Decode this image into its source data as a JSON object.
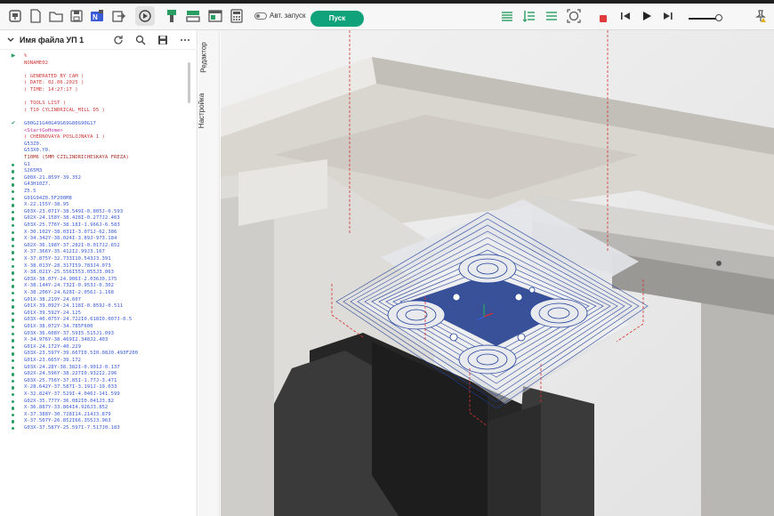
{
  "toolbar": {
    "auto_run_label": "Авт. запуск",
    "run_label": "Пуск"
  },
  "panel": {
    "file_title": "Имя файла УП 1",
    "tabs": [
      "Редактор",
      "Настройка"
    ]
  },
  "code_lines": [
    {
      "marker": "arrow",
      "text": "%",
      "style": "red"
    },
    {
      "marker": "",
      "text": "NONAME02",
      "style": "red"
    },
    {
      "marker": "",
      "text": "",
      "style": "red"
    },
    {
      "marker": "",
      "text": "( GENERATED BY CAM )",
      "style": "red"
    },
    {
      "marker": "",
      "text": "( DATE: 02.06.2025 )",
      "style": "red"
    },
    {
      "marker": "",
      "text": "( TIME: 14:27:17 )",
      "style": "red"
    },
    {
      "marker": "",
      "text": "",
      "style": "red"
    },
    {
      "marker": "",
      "text": "( TOOLS LIST )",
      "style": "red"
    },
    {
      "marker": "",
      "text": "( T10 CYLINDRICAL_MILL D5 )",
      "style": "red"
    },
    {
      "marker": "",
      "text": "",
      "style": "red"
    },
    {
      "marker": "check",
      "text": "G00G21G40G49G69G80G90G17",
      "style": "blue"
    },
    {
      "marker": "",
      "text": "<StartGoHome>",
      "style": "magenta"
    },
    {
      "marker": "",
      "text": "( CHERNOVAYA POSLOJNAYA 1 )",
      "style": "red"
    },
    {
      "marker": "",
      "text": "G53Z0.",
      "style": "blue"
    },
    {
      "marker": "",
      "text": "G53X0.Y0.",
      "style": "blue"
    },
    {
      "marker": "",
      "text": "T10M6 (5MM CZILINDRICHESKAYA FREZA)",
      "style": "darkred"
    },
    {
      "marker": "dot",
      "text": "G1",
      "style": "blue"
    },
    {
      "marker": "dot",
      "text": "S265M3",
      "style": "blue"
    },
    {
      "marker": "dot",
      "text": "G00X-21.859Y-39.352",
      "style": "blue"
    },
    {
      "marker": "dot",
      "text": "G43H10Z7.",
      "style": "blue"
    },
    {
      "marker": "dot",
      "text": "Z5.5",
      "style": "blue"
    },
    {
      "marker": "dot",
      "text": "G01G94Z0.5F200M8",
      "style": "blue"
    },
    {
      "marker": "dot",
      "text": "X-22.155Y-38.95",
      "style": "blue"
    },
    {
      "marker": "dot",
      "text": "G03X-23.071Y-38.549I-0.805J-0.593",
      "style": "blue"
    },
    {
      "marker": "dot",
      "text": "G02X-24.158Y-38.428I-0.277J2.463",
      "style": "blue"
    },
    {
      "marker": "dot",
      "text": "G03X-25.776Y-38.18I-1.966J-6.583",
      "style": "blue"
    },
    {
      "marker": "dot",
      "text": "X-30.102Y-38.031I-3.071J-62.386",
      "style": "blue"
    },
    {
      "marker": "dot",
      "text": "X-34.342Y-38.024I-3.89J-973.184",
      "style": "blue"
    },
    {
      "marker": "dot",
      "text": "G02X-36.198Y-37.282I-0.017J2.652",
      "style": "blue"
    },
    {
      "marker": "dot",
      "text": "X-37.366Y-35.412I2.99J3.167",
      "style": "blue"
    },
    {
      "marker": "dot",
      "text": "X-37.875Y-32.733I10.543J3.391",
      "style": "blue"
    },
    {
      "marker": "dot",
      "text": "X-38.013Y-28.317I59.783J4.073",
      "style": "blue"
    },
    {
      "marker": "dot",
      "text": "X-38.021Y-25.556I553.055J3.063",
      "style": "blue"
    },
    {
      "marker": "dot",
      "text": "G03X-38.07Y-24.906I-2.036J0.175",
      "style": "blue"
    },
    {
      "marker": "dot",
      "text": "X-38.144Y-24.732I-0.953J-0.302",
      "style": "blue"
    },
    {
      "marker": "dot",
      "text": "X-38.206Y-24.628I-2.056J-1.168",
      "style": "blue"
    },
    {
      "marker": "dot",
      "text": "G01X-38.219Y-24.607",
      "style": "blue"
    },
    {
      "marker": "dot",
      "text": "G01X-39.092Y-24.118I-0.859J-0.511",
      "style": "blue"
    },
    {
      "marker": "dot",
      "text": "G01X-39.592Y-24.125",
      "style": "blue"
    },
    {
      "marker": "dot",
      "text": "G03X-40.075Y-24.722I0.618I0.007J-0.5",
      "style": "blue"
    },
    {
      "marker": "dot",
      "text": "G01X-38.072Y-34.785F600",
      "style": "blue"
    },
    {
      "marker": "dot",
      "text": "G03X-36.608Y-37.59I5.515J1.093",
      "style": "blue"
    },
    {
      "marker": "dot",
      "text": "X-34.976Y-38.469I2.348J2.403",
      "style": "blue"
    },
    {
      "marker": "dot",
      "text": "G01X-24.172Y-40.229",
      "style": "blue"
    },
    {
      "marker": "dot",
      "text": "G03X-23.597Y-39.667I0.5I0.08J0.493F200",
      "style": "blue"
    },
    {
      "marker": "dot",
      "text": "G01X-23.665Y-39.172",
      "style": "blue"
    },
    {
      "marker": "dot",
      "text": "G03X-24.28Y-38.382I-0.901J-0.137",
      "style": "blue"
    },
    {
      "marker": "dot",
      "text": "G02X-24.596Y-38.227I0.932I2.296",
      "style": "blue"
    },
    {
      "marker": "dot",
      "text": "G03X-25.756Y-37.85I-1.77J-3.471",
      "style": "blue"
    },
    {
      "marker": "dot",
      "text": "X-28.642Y-37.587I-3.191J-19.033",
      "style": "blue"
    },
    {
      "marker": "dot",
      "text": "X-32.824Y-37.529I-4.046J-141.599",
      "style": "blue"
    },
    {
      "marker": "dot",
      "text": "G02X-35.777Y-36.082I0.041J3.82",
      "style": "blue"
    },
    {
      "marker": "dot",
      "text": "X-36.887Y-33.864I4.926J3.852",
      "style": "blue"
    },
    {
      "marker": "dot",
      "text": "X-37.388Y-30.728I14.214J3.879",
      "style": "blue"
    },
    {
      "marker": "dot",
      "text": "X-37.507Y-26.852I66.355J3.963",
      "style": "blue"
    },
    {
      "marker": "dot",
      "text": "G03X-37.587Y-25.597I-7.517J0.183",
      "style": "blue"
    }
  ]
}
